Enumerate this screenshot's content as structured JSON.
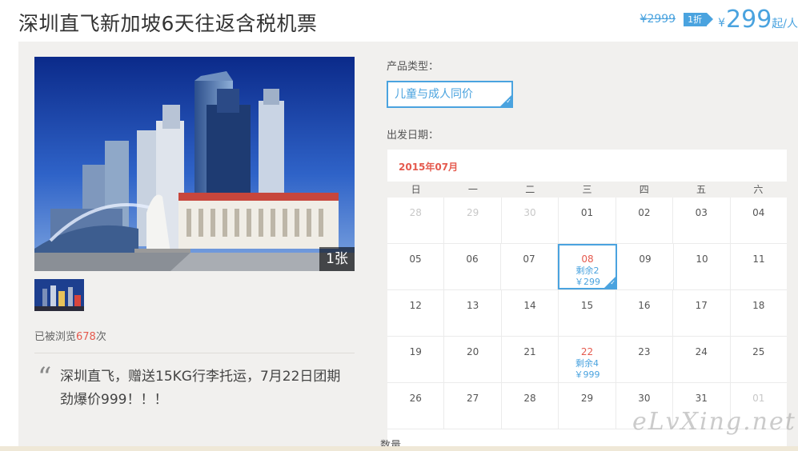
{
  "title": "深圳直飞新加坡6天往返含税机票",
  "price": {
    "original": "¥2999",
    "discount": "1折",
    "currency": "¥",
    "current": "299",
    "suffix": "起/人"
  },
  "gallery": {
    "photo_count": "1张"
  },
  "views": {
    "prefix": "已被浏览",
    "count": "678",
    "suffix": "次"
  },
  "quote": {
    "mark": "“",
    "text": "深圳直飞，赠送15KG行李托运，7月22日团期劲爆价999！！！"
  },
  "product_type": {
    "label": "产品类型：",
    "selected": "儿童与成人同价"
  },
  "departure": {
    "label": "出发日期："
  },
  "calendar": {
    "month": "2015年07月",
    "weekdays": [
      "日",
      "一",
      "二",
      "三",
      "四",
      "五",
      "六"
    ],
    "weeks": [
      [
        {
          "day": "28",
          "muted": true
        },
        {
          "day": "29",
          "muted": true
        },
        {
          "day": "30",
          "muted": true
        },
        {
          "day": "01"
        },
        {
          "day": "02"
        },
        {
          "day": "03"
        },
        {
          "day": "04"
        }
      ],
      [
        {
          "day": "05"
        },
        {
          "day": "06"
        },
        {
          "day": "07"
        },
        {
          "day": "08",
          "stock": "剩余2",
          "price": "￥299",
          "selected": true
        },
        {
          "day": "09"
        },
        {
          "day": "10"
        },
        {
          "day": "11"
        }
      ],
      [
        {
          "day": "12"
        },
        {
          "day": "13"
        },
        {
          "day": "14"
        },
        {
          "day": "15"
        },
        {
          "day": "16"
        },
        {
          "day": "17"
        },
        {
          "day": "18"
        }
      ],
      [
        {
          "day": "19"
        },
        {
          "day": "20"
        },
        {
          "day": "21"
        },
        {
          "day": "22",
          "stock": "剩余4",
          "price": "￥999"
        },
        {
          "day": "23"
        },
        {
          "day": "24"
        },
        {
          "day": "25"
        }
      ],
      [
        {
          "day": "26"
        },
        {
          "day": "27"
        },
        {
          "day": "28"
        },
        {
          "day": "29"
        },
        {
          "day": "30"
        },
        {
          "day": "31"
        },
        {
          "day": "01",
          "muted": true
        }
      ]
    ]
  },
  "quantity": {
    "label": "数量"
  },
  "watermark": "eLvXing.net",
  "colors": {
    "accent": "#4aa3df",
    "highlight": "#e55a4e",
    "panel_bg": "#f1f0ee"
  }
}
